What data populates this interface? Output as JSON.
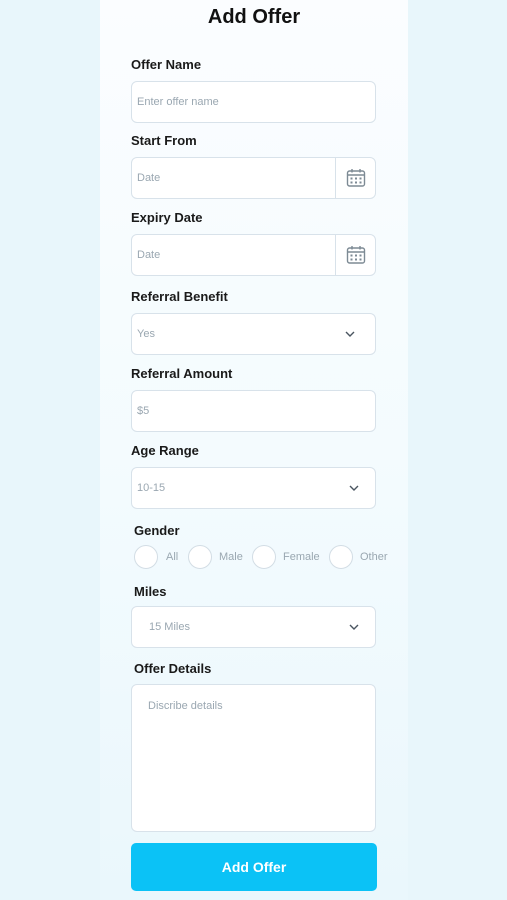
{
  "title": "Add Offer",
  "offer_name": {
    "label": "Offer Name",
    "placeholder": "Enter offer name"
  },
  "start_from": {
    "label": "Start From",
    "placeholder": "Date",
    "icon": "calendar-icon"
  },
  "expiry_date": {
    "label": "Expiry Date",
    "placeholder": "Date",
    "icon": "calendar-icon"
  },
  "referral_benefit": {
    "label": "Referral Benefit",
    "value": "Yes",
    "icon": "chevron-down-icon"
  },
  "referral_amount": {
    "label": "Referral Amount",
    "value": "$5"
  },
  "age_range": {
    "label": "Age Range",
    "value": "10-15",
    "icon": "chevron-down-icon"
  },
  "gender": {
    "label": "Gender",
    "options": [
      "All",
      "Male",
      "Female",
      "Other"
    ]
  },
  "miles": {
    "label": "Miles",
    "value": "15 Miles",
    "icon": "chevron-down-icon"
  },
  "offer_details": {
    "label": "Offer Details",
    "placeholder": "Discribe details"
  },
  "submit_label": "Add Offer",
  "colors": {
    "accent": "#0bc2f6",
    "border": "#d8e2ea",
    "placeholder": "#9aa7b1",
    "background": "#e8f6fb"
  }
}
